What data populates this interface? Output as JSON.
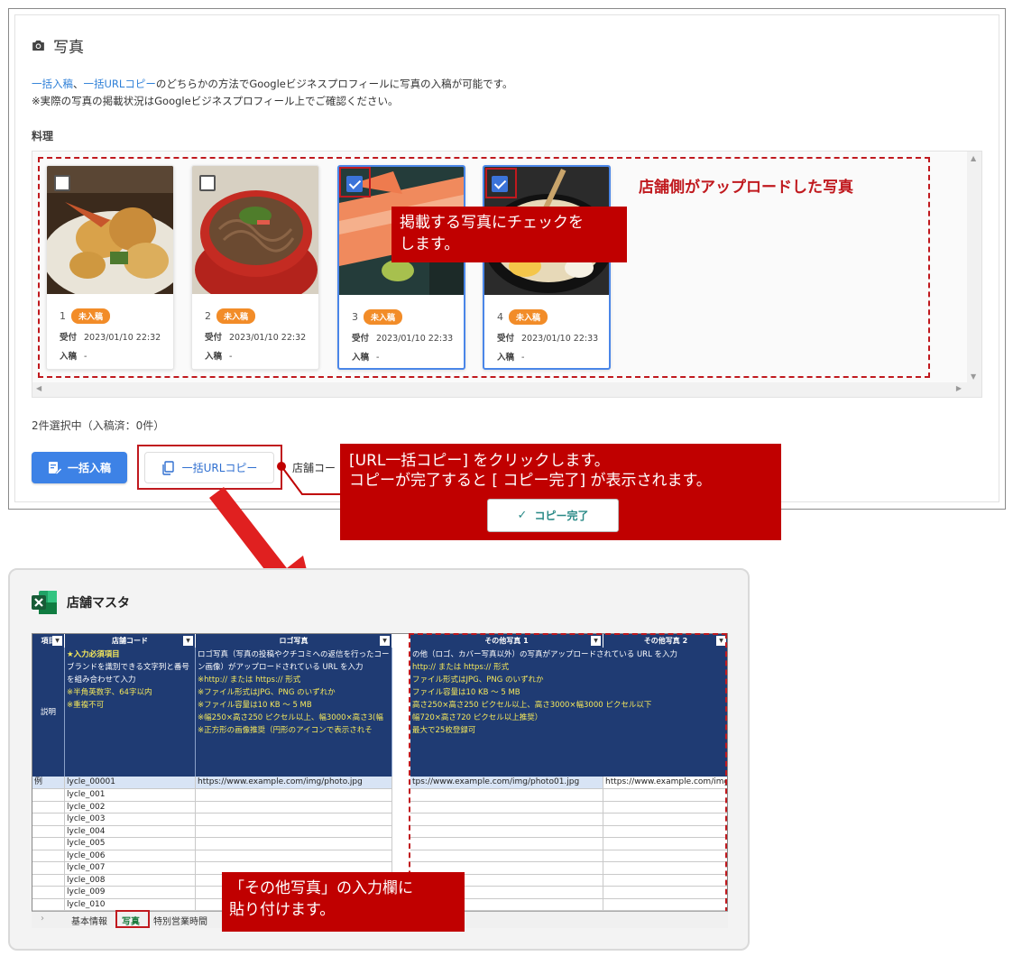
{
  "section": {
    "title": "写真"
  },
  "intro": {
    "link1": "一括入稿",
    "sep": "、",
    "link2": "一括URLコピー",
    "line1_rest": "のどちらかの方法でGoogleビジネスプロフィールに写真の入稿が可能です。",
    "line2": "※実際の写真の掲載状況はGoogleビジネスプロフィール上でご確認ください。"
  },
  "category": "料理",
  "photos": [
    {
      "num": "1",
      "badge": "未入稿",
      "received_label": "受付",
      "received": "2023/01/10 22:32",
      "submitted_label": "入稿",
      "submitted": "-",
      "checked": false
    },
    {
      "num": "2",
      "badge": "未入稿",
      "received_label": "受付",
      "received": "2023/01/10 22:32",
      "submitted_label": "入稿",
      "submitted": "-",
      "checked": false
    },
    {
      "num": "3",
      "badge": "未入稿",
      "received_label": "受付",
      "received": "2023/01/10 22:33",
      "submitted_label": "入稿",
      "submitted": "-",
      "checked": true
    },
    {
      "num": "4",
      "badge": "未入稿",
      "received_label": "受付",
      "received": "2023/01/10 22:33",
      "submitted_label": "入稿",
      "submitted": "-",
      "checked": true
    }
  ],
  "annotations": {
    "store_uploaded": "店舗側がアップロードした写真",
    "check_line1": "掲載する写真にチェックを",
    "check_line2": "します。",
    "copy_line1": "[URL一括コピー] をクリックします。",
    "copy_line2": "コピーが完了すると [ コピー完了] が表示されます。",
    "paste_line1": "「その他写真」の入力欄に",
    "paste_line2": "貼り付けます。"
  },
  "selection_status": "2件選択中（入稿済：0件）",
  "buttons": {
    "bulk_submit": "一括入稿",
    "bulk_url_copy": "一括URLコピー",
    "copy_done": "コピー完了"
  },
  "store_label": "店舗コー",
  "excel": {
    "title": "店舗マスタ",
    "headers": [
      "項目",
      "店舗コード",
      "ロゴ写真",
      "その他写真 1",
      "その他写真 2"
    ],
    "row_label_desc": "説明",
    "desc_code": [
      "★入力必須項目",
      "ブランドを識別できる文字列と番号",
      "を組み合わせて入力",
      "※半角英数字、64字以内",
      "※重複不可"
    ],
    "desc_logo": [
      "ロゴ写真（写真の投稿やクチコミへの返信を行ったコード",
      "ン画像）がアップロードされている URL を入力",
      "※http:// または https:// 形式",
      "※ファイル形式はJPG、PNG のいずれか",
      "※ファイル容量は10 KB ～ 5 MB",
      "※幅250×高さ250 ピクセル以上、幅3000×高さ3(幅",
      "※正方形の画像推奨（円形のアイコンで表示されそ"
    ],
    "desc_other": [
      "の他（ロゴ、カバー写真以外）の写真がアップロードされている URL を入力",
      "http:// または https:// 形式",
      "ファイル形式はJPG、PNG のいずれか",
      "ファイル容量は10 KB ～ 5 MB",
      "高さ250×高さ250 ピクセル以上、高さ3000×幅3000 ピクセル以下",
      "幅720×高さ720 ピクセル以上推奨）",
      "最大で25枚登録可"
    ],
    "example_label": "例",
    "example_code": "lycle_00001",
    "example_logo": "https://www.example.com/img/photo.jpg",
    "example_other1": "tps://www.example.com/img/photo01.jpg",
    "example_other2": "https://www.example.com/img/",
    "codes": [
      "lycle_001",
      "lycle_002",
      "lycle_003",
      "lycle_004",
      "lycle_005",
      "lycle_006",
      "lycle_007",
      "lycle_008",
      "lycle_009",
      "lycle_010"
    ],
    "tabs": [
      "基本情報",
      "写真",
      "特別営業時間"
    ]
  },
  "colors": {
    "accent": "#3d82e6",
    "annotation_red": "#c00000",
    "badge_orange": "#f28c28",
    "excel_header": "#1f3b73"
  }
}
